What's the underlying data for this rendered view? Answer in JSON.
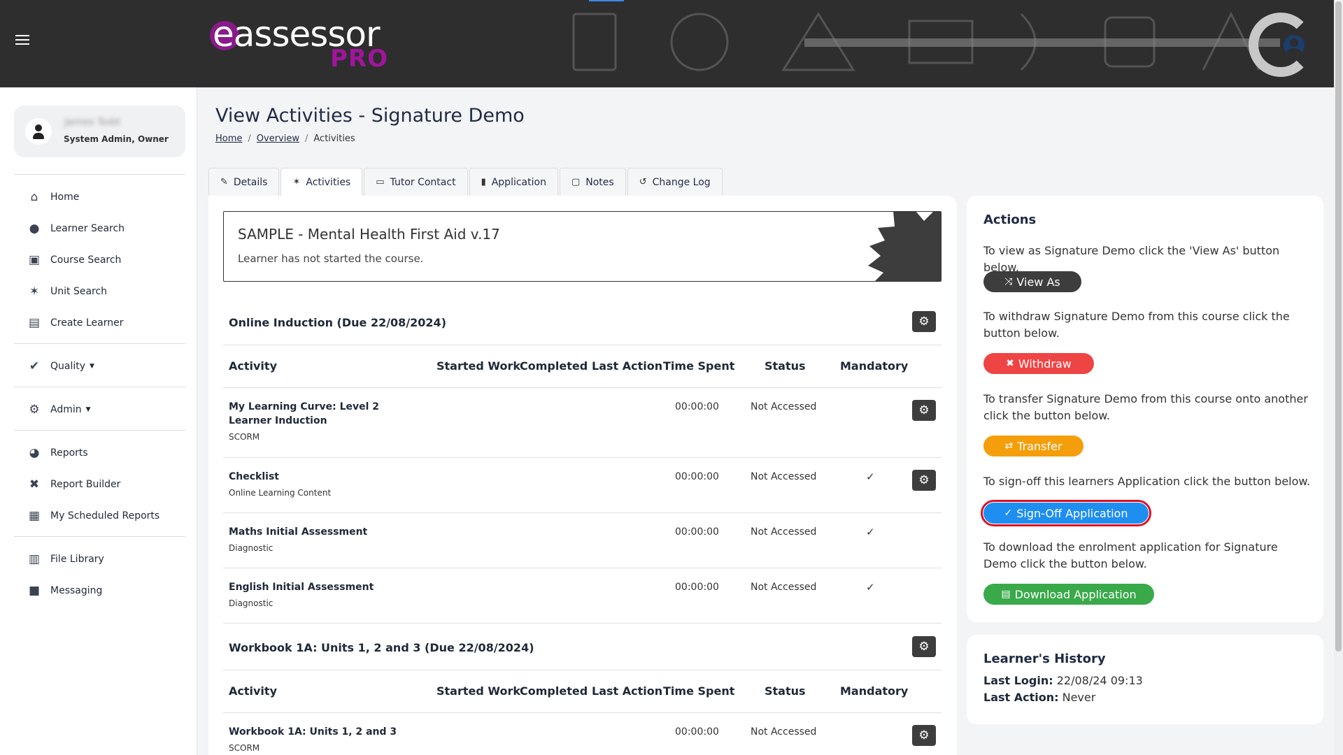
{
  "header": {
    "logo_word": "assessor",
    "logo_sub": "PRO"
  },
  "user": {
    "name": "James Todd",
    "role": "System Admin, Owner"
  },
  "nav": {
    "home": "Home",
    "learner_search": "Learner Search",
    "course_search": "Course Search",
    "unit_search": "Unit Search",
    "create_learner": "Create Learner",
    "quality": "Quality",
    "admin": "Admin",
    "reports": "Reports",
    "report_builder": "Report Builder",
    "scheduled_reports": "My Scheduled Reports",
    "file_library": "File Library",
    "messaging": "Messaging"
  },
  "page": {
    "title": "View Activities - Signature Demo",
    "breadcrumb": [
      "Home",
      "Overview",
      "Activities"
    ]
  },
  "tabs": [
    "Details",
    "Activities",
    "Tutor Contact",
    "Application",
    "Notes",
    "Change Log"
  ],
  "course": {
    "title": "SAMPLE - Mental Health First Aid v.17",
    "status": "Learner has not started the course."
  },
  "table_headers": [
    "Activity",
    "Started Work",
    "Completed",
    "Last Action",
    "Time Spent",
    "Status",
    "Mandatory"
  ],
  "sections": [
    {
      "title": "Online Induction (Due 22/08/2024)",
      "rows": [
        {
          "name": "My Learning Curve: Level 2 Learner Induction",
          "type": "SCORM",
          "time": "00:00:00",
          "status": "Not Accessed",
          "mandatory": ""
        },
        {
          "name": "Checklist",
          "type": "Online Learning Content",
          "time": "00:00:00",
          "status": "Not Accessed",
          "mandatory": "✓"
        },
        {
          "name": "Maths Initial Assessment",
          "type": "Diagnostic",
          "time": "00:00:00",
          "status": "Not Accessed",
          "mandatory": "✓"
        },
        {
          "name": "English Initial Assessment",
          "type": "Diagnostic",
          "time": "00:00:00",
          "status": "Not Accessed",
          "mandatory": "✓"
        }
      ]
    },
    {
      "title": "Workbook 1A: Units 1, 2 and 3 (Due 22/08/2024)",
      "rows": [
        {
          "name": "Workbook 1A: Units 1, 2 and 3",
          "type": "SCORM",
          "time": "00:00:00",
          "status": "Not Accessed",
          "mandatory": ""
        }
      ]
    }
  ],
  "actions": {
    "title": "Actions",
    "view_as_text": "To view as Signature Demo click the 'View As' button below.",
    "view_as_label": "View As",
    "withdraw_text": "To withdraw Signature Demo from this course click the button below.",
    "withdraw_label": "Withdraw",
    "transfer_text": "To transfer Signature Demo from this course onto another click the button below.",
    "transfer_label": "Transfer",
    "signoff_text": "To sign-off this learners Application click the button below.",
    "signoff_label": "Sign-Off Application",
    "download_text": "To download the enrolment application for Signature Demo click the button below.",
    "download_label": "Download Application"
  },
  "history": {
    "title": "Learner's History",
    "last_login_label": "Last Login:",
    "last_login_value": "22/08/24 09:13",
    "last_action_label": "Last Action:",
    "last_action_value": "Never"
  },
  "colors": {
    "header_bg": "#2e2e2e",
    "brand_purple": "#a0159c",
    "withdraw": "#ef4444",
    "transfer": "#f59e0b",
    "signoff": "#1f8ef1",
    "download": "#3aa94a",
    "highlight": "#e0101f"
  }
}
